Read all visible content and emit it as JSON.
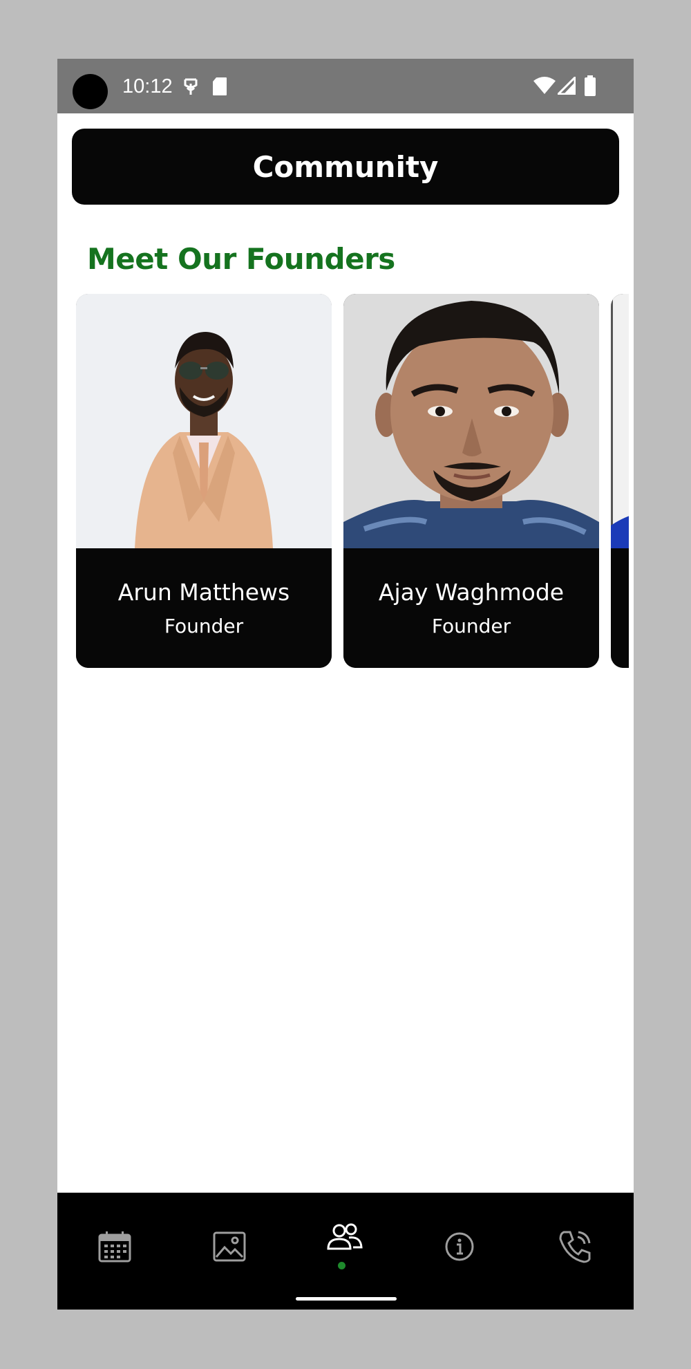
{
  "status_bar": {
    "time": "10:12"
  },
  "header": {
    "title": "Community"
  },
  "section": {
    "title": "Meet Our Founders"
  },
  "founders": [
    {
      "name": "Arun Matthews",
      "role": "Founder"
    },
    {
      "name": "Ajay Waghmode",
      "role": "Founder"
    }
  ],
  "bottom_nav": {
    "items": [
      {
        "icon": "calendar-icon",
        "active": false
      },
      {
        "icon": "gallery-icon",
        "active": false
      },
      {
        "icon": "community-icon",
        "active": true
      },
      {
        "icon": "info-icon",
        "active": false
      },
      {
        "icon": "phone-icon",
        "active": false
      }
    ]
  },
  "colors": {
    "accent_green": "#15731f",
    "active_dot": "#1e8a2c",
    "header_bg": "#070707",
    "status_bar_bg": "#777777"
  }
}
